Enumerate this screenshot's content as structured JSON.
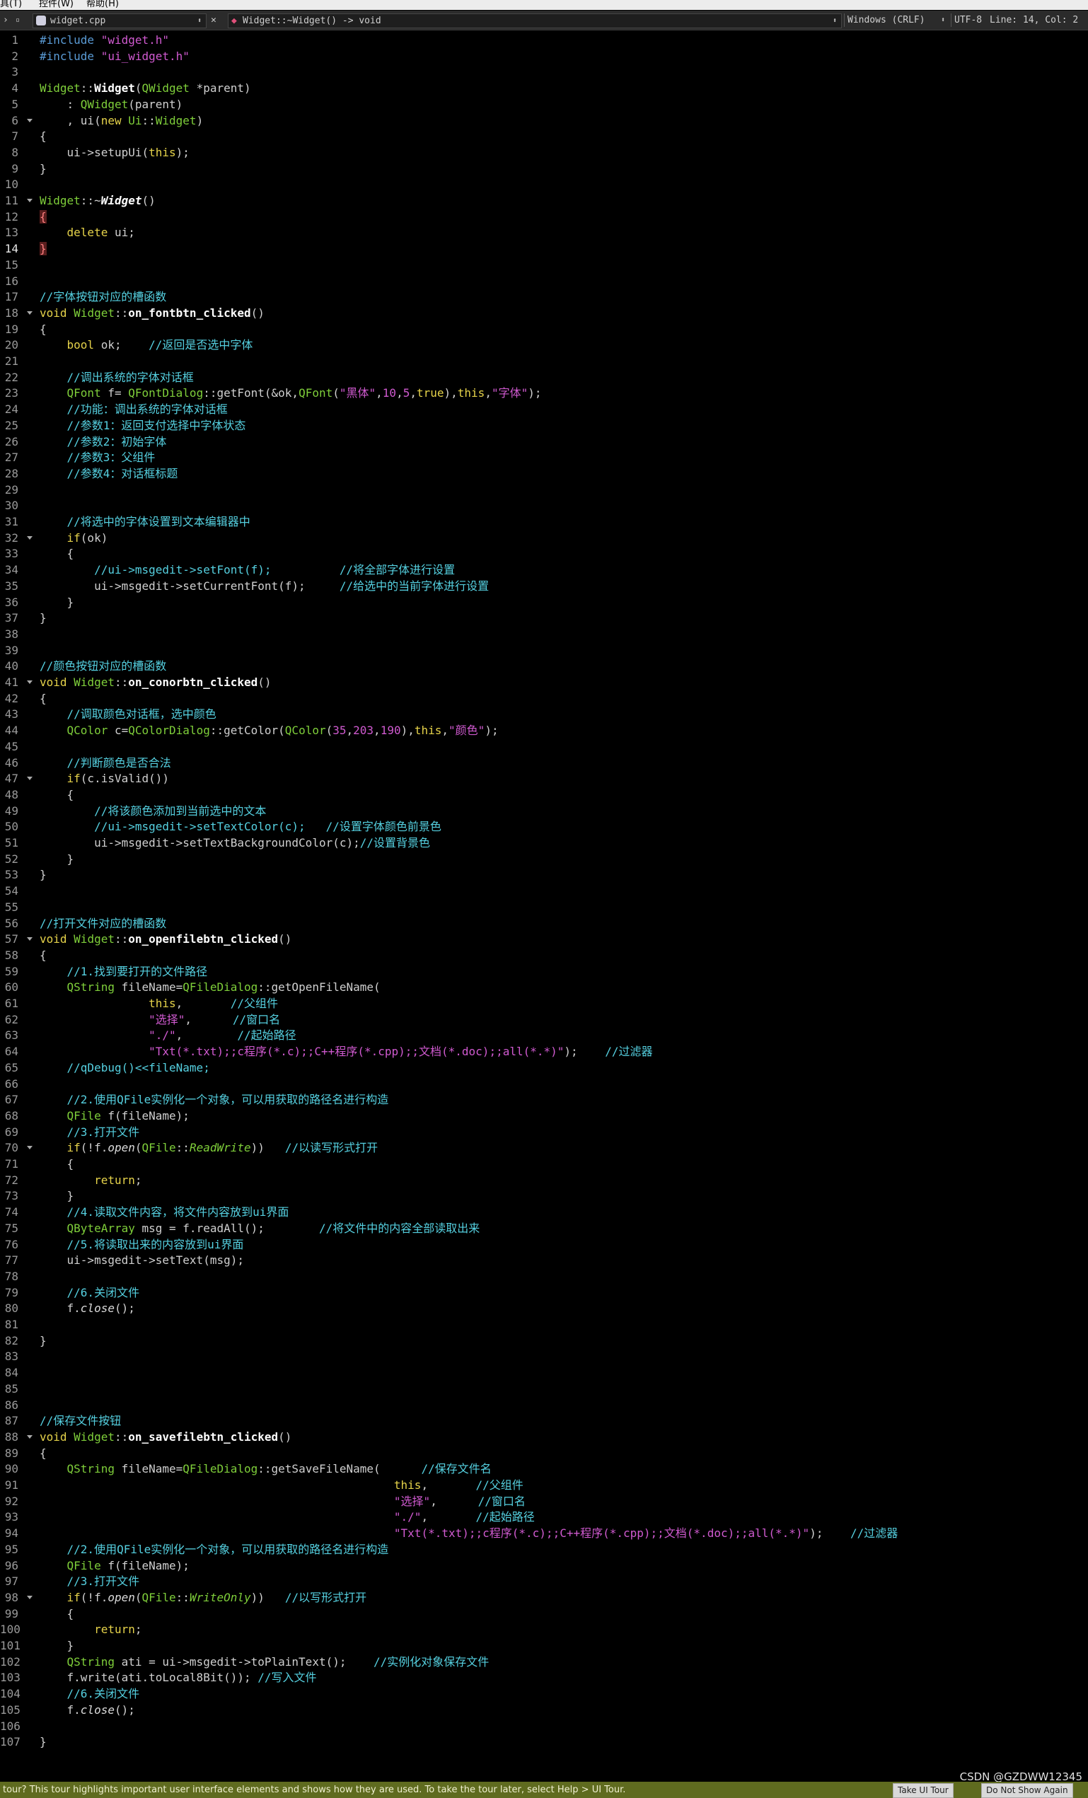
{
  "menubar": {
    "items": [
      "具(T)",
      "控件(W)",
      "帮助(H)"
    ]
  },
  "toolbar": {
    "filename": "widget.cpp",
    "function": "Widget::~Widget() -> void",
    "encoding_line_ending": "Windows (CRLF)",
    "encoding": "UTF-8",
    "position": "Line: 14, Col: 2"
  },
  "current_line": 14,
  "lines": [
    {
      "n": "1",
      "segs": [
        [
          "pp",
          "#include "
        ],
        [
          "str",
          "\"widget.h\""
        ]
      ]
    },
    {
      "n": "2",
      "segs": [
        [
          "pp",
          "#include "
        ],
        [
          "str",
          "\"ui_widget.h\""
        ]
      ]
    },
    {
      "n": "3",
      "segs": []
    },
    {
      "n": "4",
      "segs": [
        [
          "typ",
          "Widget"
        ],
        [
          "def",
          "::"
        ],
        [
          "fn",
          "Widget"
        ],
        [
          "def",
          "("
        ],
        [
          "typ",
          "QWidget"
        ],
        [
          "def",
          " *parent)"
        ]
      ]
    },
    {
      "n": "5",
      "segs": [
        [
          "def",
          "    : "
        ],
        [
          "typ",
          "QWidget"
        ],
        [
          "def",
          "(parent)"
        ]
      ]
    },
    {
      "n": "6",
      "segs": [
        [
          "def",
          "    , ui("
        ],
        [
          "kw",
          "new "
        ],
        [
          "typ",
          "Ui"
        ],
        [
          "def",
          "::"
        ],
        [
          "typ",
          "Widget"
        ],
        [
          "def",
          ")"
        ]
      ],
      "fold": true
    },
    {
      "n": "7",
      "segs": [
        [
          "def",
          "{"
        ]
      ]
    },
    {
      "n": "8",
      "segs": [
        [
          "def",
          "    ui->setupUi("
        ],
        [
          "kw",
          "this"
        ],
        [
          "def",
          ");"
        ]
      ]
    },
    {
      "n": "9",
      "segs": [
        [
          "def",
          "}"
        ]
      ]
    },
    {
      "n": "10",
      "segs": []
    },
    {
      "n": "11",
      "segs": [
        [
          "typ",
          "Widget"
        ],
        [
          "def",
          "::~"
        ],
        [
          "dtor",
          "Widget"
        ],
        [
          "def",
          "()"
        ]
      ],
      "fold": true
    },
    {
      "n": "12",
      "segs": [
        [
          "brace",
          "{"
        ]
      ]
    },
    {
      "n": "13",
      "segs": [
        [
          "kw",
          "    delete "
        ],
        [
          "def",
          "ui;"
        ]
      ]
    },
    {
      "n": "14",
      "segs": [
        [
          "brace",
          "}"
        ]
      ]
    },
    {
      "n": "15",
      "segs": []
    },
    {
      "n": "16",
      "segs": []
    },
    {
      "n": "17",
      "segs": [
        [
          "cm",
          "//字体按钮对应的槽函数"
        ]
      ]
    },
    {
      "n": "18",
      "segs": [
        [
          "kw",
          "void "
        ],
        [
          "typ",
          "Widget"
        ],
        [
          "def",
          "::"
        ],
        [
          "fn",
          "on_fontbtn_clicked"
        ],
        [
          "def",
          "()"
        ]
      ],
      "fold": true
    },
    {
      "n": "19",
      "segs": [
        [
          "def",
          "{"
        ]
      ]
    },
    {
      "n": "20",
      "segs": [
        [
          "kw",
          "    bool "
        ],
        [
          "def",
          "ok;    "
        ],
        [
          "cm",
          "//返回是否选中字体"
        ]
      ]
    },
    {
      "n": "21",
      "segs": []
    },
    {
      "n": "22",
      "segs": [
        [
          "cm",
          "    //调出系统的字体对话框"
        ]
      ]
    },
    {
      "n": "23",
      "segs": [
        [
          "typ",
          "    QFont "
        ],
        [
          "def",
          "f= "
        ],
        [
          "typ",
          "QFontDialog"
        ],
        [
          "def",
          "::getFont(&ok,"
        ],
        [
          "typ",
          "QFont"
        ],
        [
          "def",
          "("
        ],
        [
          "str",
          "\"黑体\""
        ],
        [
          "def",
          ","
        ],
        [
          "num",
          "10"
        ],
        [
          "def",
          ","
        ],
        [
          "num",
          "5"
        ],
        [
          "def",
          ","
        ],
        [
          "kw",
          "true"
        ],
        [
          "def",
          "),"
        ],
        [
          "kw",
          "this"
        ],
        [
          "def",
          ","
        ],
        [
          "str",
          "\"字体\""
        ],
        [
          "def",
          ");"
        ]
      ]
    },
    {
      "n": "24",
      "segs": [
        [
          "cm",
          "    //功能：调出系统的字体对话框"
        ]
      ]
    },
    {
      "n": "25",
      "segs": [
        [
          "cm",
          "    //参数1：返回支付选择中字体状态"
        ]
      ]
    },
    {
      "n": "26",
      "segs": [
        [
          "cm",
          "    //参数2：初始字体"
        ]
      ]
    },
    {
      "n": "27",
      "segs": [
        [
          "cm",
          "    //参数3：父组件"
        ]
      ]
    },
    {
      "n": "28",
      "segs": [
        [
          "cm",
          "    //参数4：对话框标题"
        ]
      ]
    },
    {
      "n": "29",
      "segs": []
    },
    {
      "n": "30",
      "segs": []
    },
    {
      "n": "31",
      "segs": [
        [
          "cm",
          "    //将选中的字体设置到文本编辑器中"
        ]
      ]
    },
    {
      "n": "32",
      "segs": [
        [
          "kw",
          "    if"
        ],
        [
          "def",
          "(ok)"
        ]
      ],
      "fold": true
    },
    {
      "n": "33",
      "segs": [
        [
          "def",
          "    {"
        ]
      ]
    },
    {
      "n": "34",
      "segs": [
        [
          "cm",
          "        //ui->msgedit->setFont(f);          //将全部字体进行设置"
        ]
      ]
    },
    {
      "n": "35",
      "segs": [
        [
          "def",
          "        ui->msgedit->setCurrentFont(f);     "
        ],
        [
          "cm",
          "//给选中的当前字体进行设置"
        ]
      ]
    },
    {
      "n": "36",
      "segs": [
        [
          "def",
          "    }"
        ]
      ]
    },
    {
      "n": "37",
      "segs": [
        [
          "def",
          "}"
        ]
      ]
    },
    {
      "n": "38",
      "segs": []
    },
    {
      "n": "39",
      "segs": []
    },
    {
      "n": "40",
      "segs": [
        [
          "cm",
          "//颜色按钮对应的槽函数"
        ]
      ]
    },
    {
      "n": "41",
      "segs": [
        [
          "kw",
          "void "
        ],
        [
          "typ",
          "Widget"
        ],
        [
          "def",
          "::"
        ],
        [
          "fn",
          "on_conorbtn_clicked"
        ],
        [
          "def",
          "()"
        ]
      ],
      "fold": true
    },
    {
      "n": "42",
      "segs": [
        [
          "def",
          "{"
        ]
      ]
    },
    {
      "n": "43",
      "segs": [
        [
          "cm",
          "    //调取颜色对话框，选中颜色"
        ]
      ]
    },
    {
      "n": "44",
      "segs": [
        [
          "typ",
          "    QColor "
        ],
        [
          "def",
          "c="
        ],
        [
          "typ",
          "QColorDialog"
        ],
        [
          "def",
          "::getColor("
        ],
        [
          "typ",
          "QColor"
        ],
        [
          "def",
          "("
        ],
        [
          "num",
          "35"
        ],
        [
          "def",
          ","
        ],
        [
          "num",
          "203"
        ],
        [
          "def",
          ","
        ],
        [
          "num",
          "190"
        ],
        [
          "def",
          "),"
        ],
        [
          "kw",
          "this"
        ],
        [
          "def",
          ","
        ],
        [
          "str",
          "\"颜色\""
        ],
        [
          "def",
          ");"
        ]
      ]
    },
    {
      "n": "45",
      "segs": []
    },
    {
      "n": "46",
      "segs": [
        [
          "cm",
          "    //判断颜色是否合法"
        ]
      ]
    },
    {
      "n": "47",
      "segs": [
        [
          "kw",
          "    if"
        ],
        [
          "def",
          "(c.isValid())"
        ]
      ],
      "fold": true
    },
    {
      "n": "48",
      "segs": [
        [
          "def",
          "    {"
        ]
      ]
    },
    {
      "n": "49",
      "segs": [
        [
          "cm",
          "        //将该颜色添加到当前选中的文本"
        ]
      ]
    },
    {
      "n": "50",
      "segs": [
        [
          "cm",
          "        //ui->msgedit->setTextColor(c);   //设置字体颜色前景色"
        ]
      ]
    },
    {
      "n": "51",
      "segs": [
        [
          "def",
          "        ui->msgedit->setTextBackgroundColor(c);"
        ],
        [
          "cm",
          "//设置背景色"
        ]
      ]
    },
    {
      "n": "52",
      "segs": [
        [
          "def",
          "    }"
        ]
      ]
    },
    {
      "n": "53",
      "segs": [
        [
          "def",
          "}"
        ]
      ]
    },
    {
      "n": "54",
      "segs": []
    },
    {
      "n": "55",
      "segs": []
    },
    {
      "n": "56",
      "segs": [
        [
          "cm",
          "//打开文件对应的槽函数"
        ]
      ]
    },
    {
      "n": "57",
      "segs": [
        [
          "kw",
          "void "
        ],
        [
          "typ",
          "Widget"
        ],
        [
          "def",
          "::"
        ],
        [
          "fn",
          "on_openfilebtn_clicked"
        ],
        [
          "def",
          "()"
        ]
      ],
      "fold": true
    },
    {
      "n": "58",
      "segs": [
        [
          "def",
          "{"
        ]
      ]
    },
    {
      "n": "59",
      "segs": [
        [
          "cm",
          "    //1.找到要打开的文件路径"
        ]
      ]
    },
    {
      "n": "60",
      "segs": [
        [
          "typ",
          "    QString "
        ],
        [
          "def",
          "fileName="
        ],
        [
          "typ",
          "QFileDialog"
        ],
        [
          "def",
          "::getOpenFileName("
        ]
      ]
    },
    {
      "n": "61",
      "segs": [
        [
          "kw",
          "                this"
        ],
        [
          "def",
          ",       "
        ],
        [
          "cm",
          "//父组件"
        ]
      ]
    },
    {
      "n": "62",
      "segs": [
        [
          "str",
          "                \"选择\""
        ],
        [
          "def",
          ",      "
        ],
        [
          "cm",
          "//窗口名"
        ]
      ]
    },
    {
      "n": "63",
      "segs": [
        [
          "str",
          "                \"./\""
        ],
        [
          "def",
          ",        "
        ],
        [
          "cm",
          "//起始路径"
        ]
      ]
    },
    {
      "n": "64",
      "segs": [
        [
          "str",
          "                \"Txt(*.txt);;c程序(*.c);;C++程序(*.cpp);;文档(*.doc);;all(*.*)\""
        ],
        [
          "def",
          ");    "
        ],
        [
          "cm",
          "//过滤器"
        ]
      ]
    },
    {
      "n": "65",
      "segs": [
        [
          "cm",
          "    //qDebug()<<fileName;"
        ]
      ]
    },
    {
      "n": "66",
      "segs": []
    },
    {
      "n": "67",
      "segs": [
        [
          "cm",
          "    //2.使用QFile实例化一个对象，可以用获取的路径名进行构造"
        ]
      ]
    },
    {
      "n": "68",
      "segs": [
        [
          "typ",
          "    QFile "
        ],
        [
          "def",
          "f(fileName);"
        ]
      ]
    },
    {
      "n": "69",
      "segs": [
        [
          "cm",
          "    //3.打开文件"
        ]
      ]
    },
    {
      "n": "70",
      "segs": [
        [
          "kw",
          "    if"
        ],
        [
          "def",
          "(!f."
        ],
        [
          "it",
          "open"
        ],
        [
          "def",
          "("
        ],
        [
          "typ",
          "QFile"
        ],
        [
          "def",
          "::"
        ],
        [
          "tit",
          "ReadWrite"
        ],
        [
          "def",
          "))   "
        ],
        [
          "cm",
          "//以读写形式打开"
        ]
      ],
      "fold": true
    },
    {
      "n": "71",
      "segs": [
        [
          "def",
          "    {"
        ]
      ]
    },
    {
      "n": "72",
      "segs": [
        [
          "kw",
          "        return"
        ],
        [
          "def",
          ";"
        ]
      ]
    },
    {
      "n": "73",
      "segs": [
        [
          "def",
          "    }"
        ]
      ]
    },
    {
      "n": "74",
      "segs": [
        [
          "cm",
          "    //4.读取文件内容，将文件内容放到ui界面"
        ]
      ]
    },
    {
      "n": "75",
      "segs": [
        [
          "typ",
          "    QByteArray "
        ],
        [
          "def",
          "msg = f.readAll();        "
        ],
        [
          "cm",
          "//将文件中的内容全部读取出来"
        ]
      ]
    },
    {
      "n": "76",
      "segs": [
        [
          "cm",
          "    //5.将读取出来的内容放到ui界面"
        ]
      ]
    },
    {
      "n": "77",
      "segs": [
        [
          "def",
          "    ui->msgedit->setText(msg);"
        ]
      ]
    },
    {
      "n": "78",
      "segs": []
    },
    {
      "n": "79",
      "segs": [
        [
          "cm",
          "    //6.关闭文件"
        ]
      ]
    },
    {
      "n": "80",
      "segs": [
        [
          "def",
          "    f."
        ],
        [
          "it",
          "close"
        ],
        [
          "def",
          "();"
        ]
      ]
    },
    {
      "n": "81",
      "segs": []
    },
    {
      "n": "82",
      "segs": [
        [
          "def",
          "}"
        ]
      ]
    },
    {
      "n": "83",
      "segs": []
    },
    {
      "n": "84",
      "segs": []
    },
    {
      "n": "85",
      "segs": []
    },
    {
      "n": "86",
      "segs": []
    },
    {
      "n": "87",
      "segs": [
        [
          "cm",
          "//保存文件按钮"
        ]
      ]
    },
    {
      "n": "88",
      "segs": [
        [
          "kw",
          "void "
        ],
        [
          "typ",
          "Widget"
        ],
        [
          "def",
          "::"
        ],
        [
          "fn",
          "on_savefilebtn_clicked"
        ],
        [
          "def",
          "()"
        ]
      ],
      "fold": true
    },
    {
      "n": "89",
      "segs": [
        [
          "def",
          "{"
        ]
      ]
    },
    {
      "n": "90",
      "segs": [
        [
          "typ",
          "    QString "
        ],
        [
          "def",
          "fileName="
        ],
        [
          "typ",
          "QFileDialog"
        ],
        [
          "def",
          "::getSaveFileName(      "
        ],
        [
          "cm",
          "//保存文件名"
        ]
      ]
    },
    {
      "n": "91",
      "segs": [
        [
          "kw",
          "                                                    this"
        ],
        [
          "def",
          ",       "
        ],
        [
          "cm",
          "//父组件"
        ]
      ]
    },
    {
      "n": "92",
      "segs": [
        [
          "str",
          "                                                    \"选择\""
        ],
        [
          "def",
          ",      "
        ],
        [
          "cm",
          "//窗口名"
        ]
      ]
    },
    {
      "n": "93",
      "segs": [
        [
          "str",
          "                                                    \"./\""
        ],
        [
          "def",
          ",       "
        ],
        [
          "cm",
          "//起始路径"
        ]
      ]
    },
    {
      "n": "94",
      "segs": [
        [
          "str",
          "                                                    \"Txt(*.txt);;c程序(*.c);;C++程序(*.cpp);;文档(*.doc);;all(*.*)\""
        ],
        [
          "def",
          ");    "
        ],
        [
          "cm",
          "//过滤器"
        ]
      ]
    },
    {
      "n": "95",
      "segs": [
        [
          "cm",
          "    //2.使用QFile实例化一个对象，可以用获取的路径名进行构造"
        ]
      ]
    },
    {
      "n": "96",
      "segs": [
        [
          "typ",
          "    QFile "
        ],
        [
          "def",
          "f(fileName);"
        ]
      ]
    },
    {
      "n": "97",
      "segs": [
        [
          "cm",
          "    //3.打开文件"
        ]
      ]
    },
    {
      "n": "98",
      "segs": [
        [
          "kw",
          "    if"
        ],
        [
          "def",
          "(!f."
        ],
        [
          "it",
          "open"
        ],
        [
          "def",
          "("
        ],
        [
          "typ",
          "QFile"
        ],
        [
          "def",
          "::"
        ],
        [
          "tit",
          "WriteOnly"
        ],
        [
          "def",
          "))   "
        ],
        [
          "cm",
          "//以写形式打开"
        ]
      ],
      "fold": true
    },
    {
      "n": "99",
      "segs": [
        [
          "def",
          "    {"
        ]
      ]
    },
    {
      "n": "100",
      "segs": [
        [
          "kw",
          "        return"
        ],
        [
          "def",
          ";"
        ]
      ]
    },
    {
      "n": "101",
      "segs": [
        [
          "def",
          "    }"
        ]
      ]
    },
    {
      "n": "102",
      "segs": [
        [
          "typ",
          "    QString "
        ],
        [
          "def",
          "ati = ui->msgedit->toPlainText();    "
        ],
        [
          "cm",
          "//实例化对象保存文件"
        ]
      ]
    },
    {
      "n": "103",
      "segs": [
        [
          "def",
          "    f.write(ati.toLocal8Bit()); "
        ],
        [
          "cm",
          "//写入文件"
        ]
      ]
    },
    {
      "n": "104",
      "segs": [
        [
          "cm",
          "    //6.关闭文件"
        ]
      ]
    },
    {
      "n": "105",
      "segs": [
        [
          "def",
          "    f."
        ],
        [
          "it",
          "close"
        ],
        [
          "def",
          "();"
        ]
      ]
    },
    {
      "n": "106",
      "segs": []
    },
    {
      "n": "107",
      "segs": [
        [
          "def",
          "}"
        ]
      ]
    }
  ],
  "statusbar": {
    "message": "tour? This tour highlights important user interface elements and shows how they are used. To take the tour later, select Help > UI Tour.",
    "take_tour": "Take UI Tour",
    "do_not_show": "Do Not Show Again"
  },
  "watermark": "CSDN @GZDWW12345"
}
